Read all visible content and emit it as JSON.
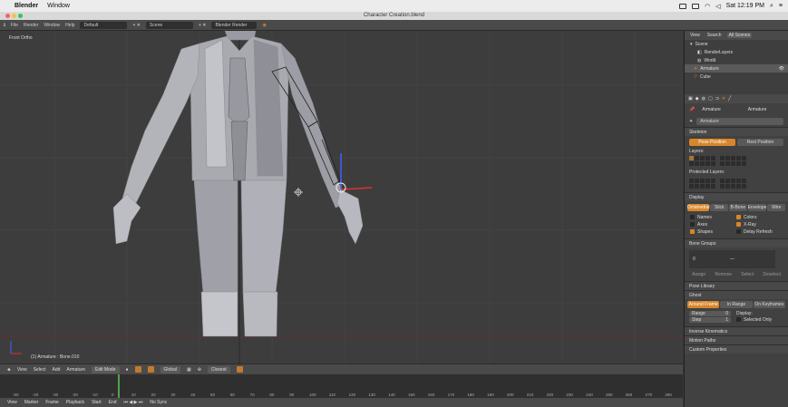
{
  "menubar": {
    "app": "Blender",
    "menu": "Window",
    "clock": "Sat 12:19 PM"
  },
  "window_title": "Character Creation.blend",
  "info_header": {
    "menus": [
      "File",
      "Render",
      "Window",
      "Help"
    ],
    "layout": "Default",
    "scene": "Scene",
    "engine": "Blender Render"
  },
  "viewport": {
    "label": "Front Ortho",
    "status": "(1) Armature : Bone.010"
  },
  "view3d_header": {
    "menus": [
      "View",
      "Select",
      "Add",
      "Armature"
    ],
    "mode": "Edit Mode",
    "orientation": "Global",
    "pivot": "Closest"
  },
  "timeline": {
    "ticks": [
      "-50",
      "-40",
      "-30",
      "-20",
      "-10",
      "0",
      "10",
      "20",
      "30",
      "40",
      "50",
      "60",
      "70",
      "80",
      "90",
      "100",
      "110",
      "120",
      "130",
      "140",
      "150",
      "160",
      "170",
      "180",
      "190",
      "200",
      "210",
      "220",
      "230",
      "240",
      "250",
      "260",
      "270",
      "280"
    ],
    "header": [
      "View",
      "Marker",
      "Frame",
      "Playback"
    ],
    "start": "Start",
    "end": "End",
    "sync": "No Sync"
  },
  "outliner": {
    "tabs": [
      "View",
      "Search",
      "All Scenes"
    ],
    "rows": [
      "Scene",
      "RenderLayers",
      "World",
      "Armature",
      "Cube"
    ]
  },
  "properties": {
    "context": [
      "Armature",
      "Armature"
    ],
    "name": "Armature",
    "skeleton": {
      "title": "Skeleton",
      "pose": "Pose Position",
      "rest": "Rest Position",
      "layers": "Layers:",
      "protected": "Protected Layers:"
    },
    "display": {
      "title": "Display",
      "modes": [
        "Octahedral",
        "Stick",
        "B-Bone",
        "Envelope",
        "Wire"
      ],
      "opts": [
        {
          "l": "Names",
          "on": false
        },
        {
          "l": "Colors",
          "on": true
        },
        {
          "l": "Axes",
          "on": false
        },
        {
          "l": "X-Ray",
          "on": true
        },
        {
          "l": "Shapes",
          "on": true
        },
        {
          "l": "Delay Refresh",
          "on": false
        }
      ]
    },
    "bone_groups": {
      "title": "Bone Groups",
      "row": "0",
      "buttons": [
        "Assign",
        "Remove",
        "Select",
        "Deselect"
      ]
    },
    "pose_library": "Pose Library",
    "ghost": {
      "title": "Ghost",
      "modes": [
        "Around Frame",
        "In Range",
        "On Keyframes"
      ],
      "range_label": "Range",
      "range": "0",
      "step_label": "Step",
      "step": "1",
      "display": "Display:",
      "selected_only": "Selected Only"
    },
    "collapsed": [
      "Inverse Kinematics",
      "Motion Paths",
      "Custom Properties"
    ]
  },
  "colors": {
    "accent": "#d8862b",
    "bg": "#3d3d3d"
  }
}
